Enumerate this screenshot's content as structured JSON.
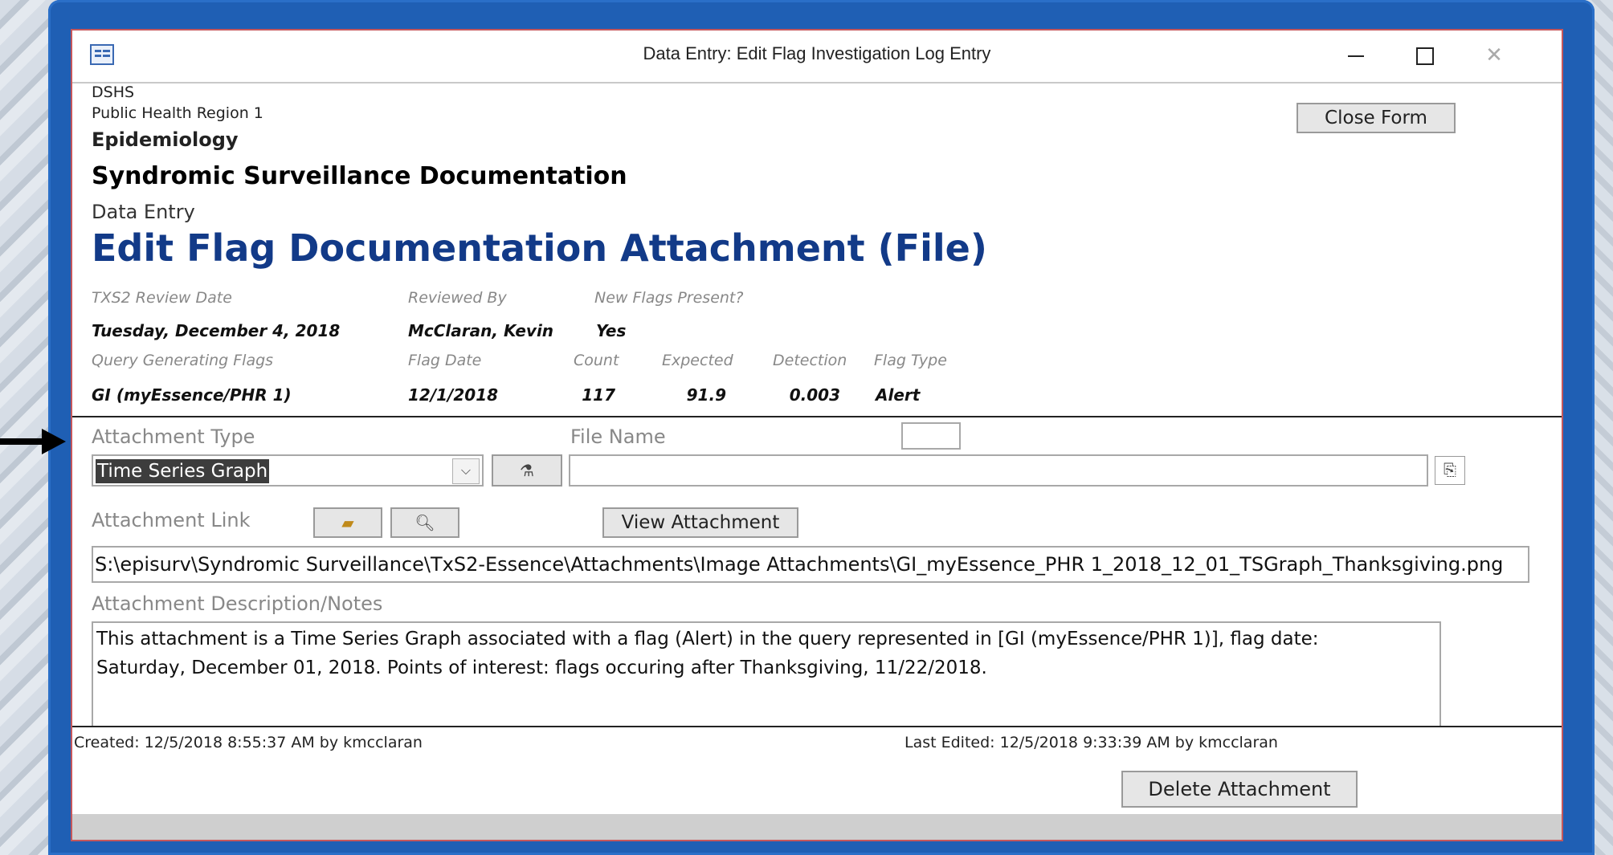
{
  "window": {
    "title": "Data Entry: Edit Flag Investigation Log Entry"
  },
  "header": {
    "org": "DSHS",
    "region": "Public Health Region 1",
    "dept": "Epidemiology",
    "section": "Syndromic Surveillance Documentation",
    "subsection": "Data Entry",
    "page_title": "Edit Flag Documentation Attachment (File)"
  },
  "buttons": {
    "close_form": "Close Form",
    "view_attachment": "View Attachment",
    "delete_attachment": "Delete Attachment"
  },
  "review": {
    "review_date_label": "TXS2 Review Date",
    "review_date": "Tuesday, December 4, 2018",
    "reviewed_by_label": "Reviewed By",
    "reviewed_by": "McClaran, Kevin",
    "new_flags_label": "New Flags Present?",
    "new_flags": "Yes"
  },
  "query": {
    "query_label": "Query Generating Flags",
    "query": "GI (myEssence/PHR 1)",
    "flag_date_label": "Flag Date",
    "flag_date": "12/1/2018",
    "count_label": "Count",
    "count": "117",
    "expected_label": "Expected",
    "expected": "91.9",
    "detection_label": "Detection",
    "detection": "0.003",
    "flag_type_label": "Flag Type",
    "flag_type": "Alert"
  },
  "attachment": {
    "type_label": "Attachment Type",
    "type_value": "Time Series Graph",
    "file_name_label": "File Name",
    "file_name": "",
    "link_label": "Attachment Link",
    "link": "S:\\episurv\\Syndromic Surveillance\\TxS2-Essence\\Attachments\\Image Attachments\\GI_myEssence_PHR 1_2018_12_01_TSGraph_Thanksgiving.png",
    "notes_label": "Attachment Description/Notes",
    "notes_line1": "This attachment is a Time Series Graph associated with a flag (Alert) in the query represented in [GI (myEssence/PHR 1)], flag date:",
    "notes_line2": "Saturday, December 01, 2018. Points of interest: flags occuring after Thanksgiving, 11/22/2018."
  },
  "footer": {
    "created": "Created: 12/5/2018 8:55:37 AM by kmcclaran",
    "last_edited": "Last Edited: 12/5/2018 9:33:39 AM by kmcclaran"
  },
  "icons": [
    "app-form-icon",
    "minimize-icon",
    "maximize-icon",
    "close-icon",
    "dropdown-arrow-icon",
    "wizard-icon",
    "copy-icon",
    "browse-folder-icon",
    "preview-icon",
    "pointer-arrow-icon"
  ]
}
